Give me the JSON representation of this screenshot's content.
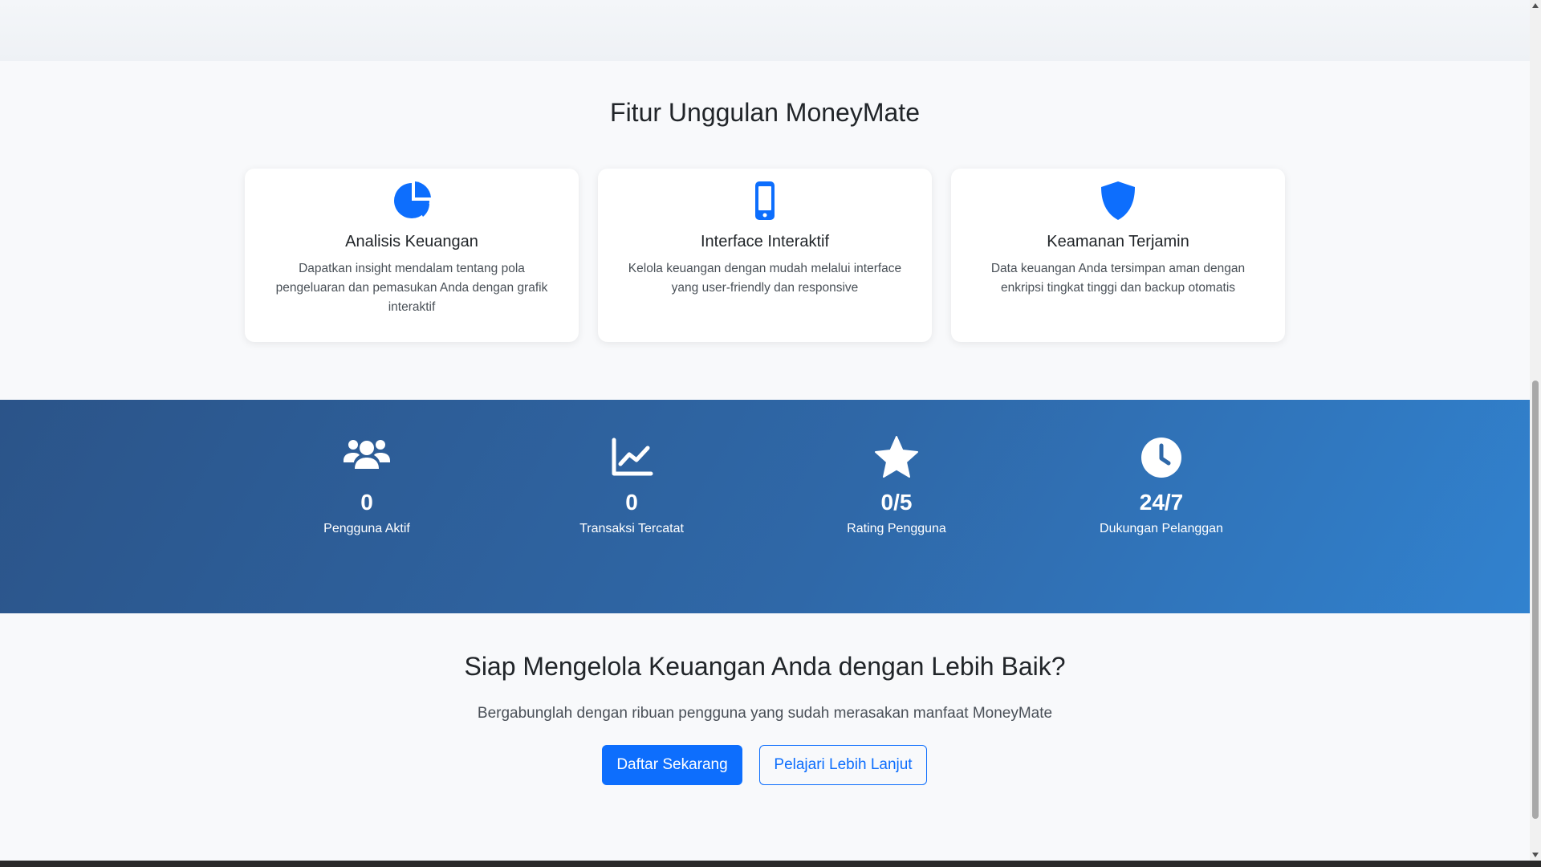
{
  "colors": {
    "accent": "#0d6efd",
    "stats_gradient_start": "#2b5489",
    "stats_gradient_end": "#3182cf"
  },
  "features": {
    "title": "Fitur Unggulan MoneyMate",
    "cards": [
      {
        "icon": "pie-chart-icon",
        "title": "Analisis Keuangan",
        "text": "Dapatkan insight mendalam tentang pola pengeluaran dan pemasukan Anda dengan grafik interaktif"
      },
      {
        "icon": "mobile-phone-icon",
        "title": "Interface Interaktif",
        "text": "Kelola keuangan dengan mudah melalui interface yang user-friendly dan responsive"
      },
      {
        "icon": "shield-icon",
        "title": "Keamanan Terjamin",
        "text": "Data keuangan Anda tersimpan aman dengan enkripsi tingkat tinggi dan backup otomatis"
      }
    ]
  },
  "stats": [
    {
      "icon": "users-icon",
      "value": "0",
      "label": "Pengguna Aktif"
    },
    {
      "icon": "line-chart-icon",
      "value": "0",
      "label": "Transaksi Tercatat"
    },
    {
      "icon": "star-icon",
      "value": "0/5",
      "label": "Rating Pengguna"
    },
    {
      "icon": "clock-icon",
      "value": "24/7",
      "label": "Dukungan Pelanggan"
    }
  ],
  "cta": {
    "title": "Siap Mengelola Keuangan Anda dengan Lebih Baik?",
    "subtitle": "Bergabunglah dengan ribuan pengguna yang sudah merasakan manfaat MoneyMate",
    "primary_button": "Daftar Sekarang",
    "secondary_button": "Pelajari Lebih Lanjut"
  }
}
